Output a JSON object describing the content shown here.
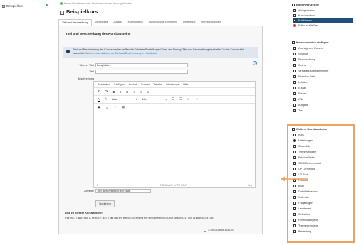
{
  "left_tree": {
    "item": "Beispielkurs"
  },
  "status_message": "Keine Probleme oder Fehler in diesem Kurs gefunden",
  "page_title": "Beispielkurs",
  "tabs": [
    "Titel und Beschreibung",
    "Sichtbarkeit",
    "Zugang",
    "Konfiguration",
    "Automatische Erinnerung",
    "Bewertung",
    "Mehrsprachigkeit"
  ],
  "section_title": "Titel und Beschreibung des Kursbausteins",
  "info": {
    "text": "Titel und Beschreibung des Kurses werden im Bereich \"Weitere Einstellungen\" über den Eintrag \"Titel und Beschreibung bearbeiten\" in der Kursansicht bearbeitet.",
    "link": "Weitere Informationen zu Titel und Beschreibung im Handbuch"
  },
  "form": {
    "short_title_label": "Kurzer Titel",
    "short_title_value": "Beispielkurs",
    "title_label": "Titel",
    "title_value": "",
    "description_label": "Beschreibung",
    "display_label": "Anzeige",
    "display_value": "Titel, Beschreibung und Inhalt"
  },
  "editor": {
    "menu": [
      "Bearbeiten",
      "Einfügen",
      "Ansicht",
      "Format",
      "Tabelle",
      "Werkzeuge",
      "Hilfe"
    ],
    "font": "Arial",
    "size": "10pt",
    "footer_left": "P",
    "footer_hint": "PRESS ALT+0 FOR HELP",
    "footer_brand": "tiny"
  },
  "save_button": "Speichern",
  "link_heading": "Link zu diesem Kursbaustein",
  "link_url": "https://www.opal-schule.de/olat/auth/RepositoryEntry/40040000000/CourseNode/1745571666661441301",
  "node_id": "1745571666661441301",
  "sidebar": {
    "tools_heading": "Editorwerkzeuge",
    "tools": [
      "Ablageordner",
      "Kursvorschau",
      "Publizieren",
      "Editor schließen"
    ],
    "active_tool": "Publizieren",
    "insert_heading": "Kursbausteine einfügen",
    "insert": [
      "Aus eigenen Kursen",
      "Struktur",
      "Einschreibung",
      "Ordner",
      "Virtuelles Klassenzimmer",
      "Einfache Seite",
      "Lektüre",
      "E-Mail",
      "Forum",
      "Wiki",
      "Aufgabe",
      "Test"
    ],
    "more_heading": "Weitere Kursbausteine",
    "more": [
      "Kurs",
      "Mitteilungen",
      "Checkliste",
      "Terminvergabe",
      "Externe Seite",
      "SCORM-Lerninhalt",
      "CP Lerninhalt",
      "LTI Tool",
      "Podcast",
      "Blog",
      "Dateidiskussion",
      "Kalender",
      "Fragebogen",
      "Lernkarten",
      "Selbsttest",
      "Portfolioaufgabe",
      "Themenvergabe",
      "Bewertung"
    ],
    "highlighted_item": "LTI Tool",
    "accent_color": "#f0a25a"
  }
}
